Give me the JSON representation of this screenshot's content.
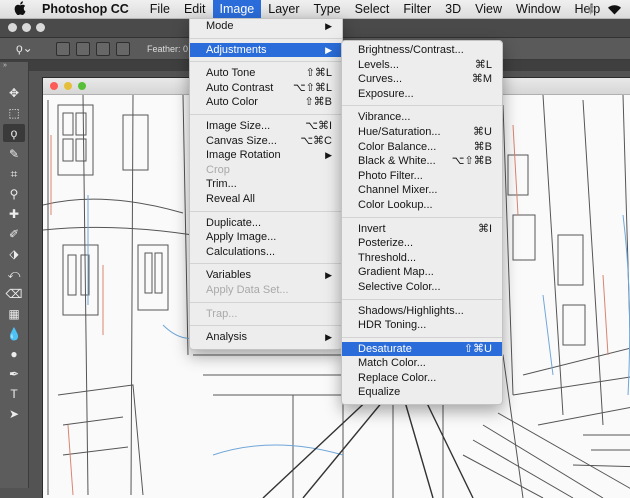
{
  "menubar": {
    "apple_icon": "apple-logo-icon",
    "app_name": "Photoshop CC",
    "items": [
      "File",
      "Edit",
      "Image",
      "Layer",
      "Type",
      "Select",
      "Filter",
      "3D",
      "View",
      "Window",
      "Help"
    ],
    "active": "Image",
    "icons": [
      "bluetooth-icon",
      "wifi-icon"
    ]
  },
  "options_bar": {
    "feather_label": "Feather:",
    "feather_value": "0"
  },
  "image_menu": {
    "items": [
      {
        "label": "Mode",
        "arrow": "▶"
      },
      {
        "sep": true
      },
      {
        "label": "Adjustments",
        "arrow": "▶",
        "highlighted": true
      },
      {
        "sep": true
      },
      {
        "label": "Auto Tone",
        "shortcut": "⇧⌘L"
      },
      {
        "label": "Auto Contrast",
        "shortcut": "⌥⇧⌘L"
      },
      {
        "label": "Auto Color",
        "shortcut": "⇧⌘B"
      },
      {
        "sep": true
      },
      {
        "label": "Image Size...",
        "shortcut": "⌥⌘I"
      },
      {
        "label": "Canvas Size...",
        "shortcut": "⌥⌘C"
      },
      {
        "label": "Image Rotation",
        "arrow": "▶"
      },
      {
        "label": "Crop",
        "disabled": true
      },
      {
        "label": "Trim..."
      },
      {
        "label": "Reveal All"
      },
      {
        "sep": true
      },
      {
        "label": "Duplicate..."
      },
      {
        "label": "Apply Image..."
      },
      {
        "label": "Calculations..."
      },
      {
        "sep": true
      },
      {
        "label": "Variables",
        "arrow": "▶"
      },
      {
        "label": "Apply Data Set...",
        "disabled": true
      },
      {
        "sep": true
      },
      {
        "label": "Trap...",
        "disabled": true
      },
      {
        "sep": true
      },
      {
        "label": "Analysis",
        "arrow": "▶"
      }
    ]
  },
  "adjustments_menu": {
    "items": [
      {
        "label": "Brightness/Contrast..."
      },
      {
        "label": "Levels...",
        "shortcut": "⌘L"
      },
      {
        "label": "Curves...",
        "shortcut": "⌘M"
      },
      {
        "label": "Exposure..."
      },
      {
        "sep": true
      },
      {
        "label": "Vibrance..."
      },
      {
        "label": "Hue/Saturation...",
        "shortcut": "⌘U"
      },
      {
        "label": "Color Balance...",
        "shortcut": "⌘B"
      },
      {
        "label": "Black & White...",
        "shortcut": "⌥⇧⌘B"
      },
      {
        "label": "Photo Filter..."
      },
      {
        "label": "Channel Mixer..."
      },
      {
        "label": "Color Lookup..."
      },
      {
        "sep": true
      },
      {
        "label": "Invert",
        "shortcut": "⌘I"
      },
      {
        "label": "Posterize..."
      },
      {
        "label": "Threshold..."
      },
      {
        "label": "Gradient Map..."
      },
      {
        "label": "Selective Color..."
      },
      {
        "sep": true
      },
      {
        "label": "Shadows/Highlights..."
      },
      {
        "label": "HDR Toning..."
      },
      {
        "sep": true
      },
      {
        "label": "Desaturate",
        "shortcut": "⇧⌘U",
        "highlighted": true
      },
      {
        "label": "Match Color..."
      },
      {
        "label": "Replace Color..."
      },
      {
        "label": "Equalize"
      }
    ]
  },
  "tools": [
    "move-tool-icon",
    "marquee-tool-icon",
    "lasso-tool-icon",
    "quick-selection-tool-icon",
    "crop-tool-icon",
    "eyedropper-tool-icon",
    "healing-brush-tool-icon",
    "brush-tool-icon",
    "clone-stamp-tool-icon",
    "history-brush-tool-icon",
    "eraser-tool-icon",
    "gradient-tool-icon",
    "blur-tool-icon",
    "dodge-tool-icon",
    "pen-tool-icon",
    "type-tool-icon",
    "path-selection-tool-icon"
  ],
  "colors": {
    "accent": "#2a6cd9",
    "menu_bg": "#ededed",
    "ps_dark": "#535353"
  }
}
